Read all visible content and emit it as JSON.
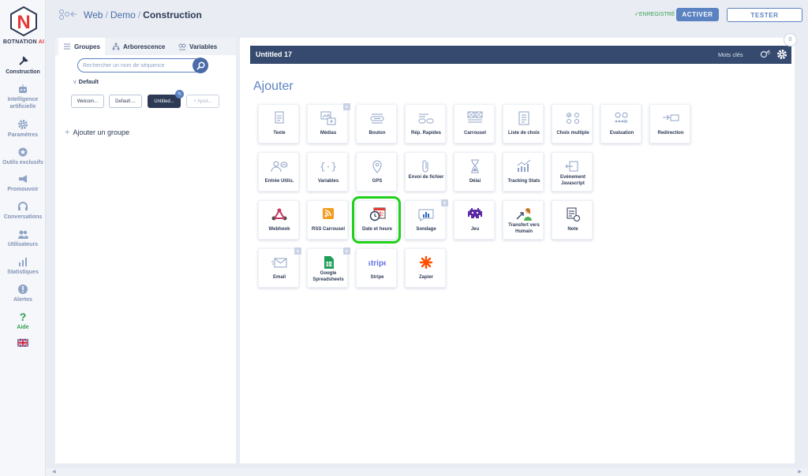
{
  "brand": {
    "name": "BOTNATION",
    "suffix": "AI",
    "logo_letter": "N"
  },
  "sidebar": {
    "items": [
      {
        "label": "Construction",
        "icon": "wrench-icon"
      },
      {
        "label": "Intelligence artificielle",
        "icon": "robot-icon"
      },
      {
        "label": "Paramètres",
        "icon": "gear-icon"
      },
      {
        "label": "Outils exclusifs",
        "icon": "star-gear-icon"
      },
      {
        "label": "Promouvoir",
        "icon": "megaphone-icon"
      },
      {
        "label": "Conversations",
        "icon": "headset-icon"
      },
      {
        "label": "Utilisateurs",
        "icon": "users-icon"
      },
      {
        "label": "Statistiques",
        "icon": "stats-icon"
      },
      {
        "label": "Alertes",
        "icon": "alert-icon"
      },
      {
        "label": "Aide",
        "icon": "question-icon"
      }
    ],
    "language_flag": "uk-flag-icon"
  },
  "header": {
    "crumb1": "Web",
    "crumb2": "Demo",
    "crumb3": "Construction",
    "sep": "/",
    "saved": "ENREGISTRÉ",
    "activate": "ACTIVER",
    "test": "TESTER"
  },
  "left_panel": {
    "tabs": [
      "Groupes",
      "Arborescence",
      "Variables"
    ],
    "search_placeholder": "Rechercher un nom de séquence",
    "group_name": "Default",
    "sequences": [
      "Welcom...",
      "Default ...",
      "Untitled..."
    ],
    "add_sequence": "+ Ajout...",
    "add_group": "Ajouter un groupe"
  },
  "main": {
    "title": "Untitled 17",
    "keywords": "Mots clés",
    "counter": "0",
    "section": "Ajouter",
    "highlight_color": "#1fd11a",
    "accent": "#5b82c1",
    "cards": [
      {
        "label": "Texte",
        "icon": "text-icon"
      },
      {
        "label": "Médias",
        "icon": "media-icon",
        "plus": true
      },
      {
        "label": "Bouton",
        "icon": "button-icon"
      },
      {
        "label": "Rép. Rapides",
        "icon": "quick-replies-icon"
      },
      {
        "label": "Carrousel",
        "icon": "carousel-icon"
      },
      {
        "label": "Liste de choix",
        "icon": "choice-list-icon"
      },
      {
        "label": "Choix multiple",
        "icon": "multiple-choice-icon"
      },
      {
        "label": "Evaluation",
        "icon": "rating-icon"
      },
      {
        "label": "Redirection",
        "icon": "redirect-icon"
      },
      {
        "label": "Entrée Utilis.",
        "icon": "user-input-icon"
      },
      {
        "label": "Variables",
        "icon": "variables-icon"
      },
      {
        "label": "GPS",
        "icon": "gps-icon"
      },
      {
        "label": "Envoi de fichier",
        "icon": "file-upload-icon"
      },
      {
        "label": "Délai",
        "icon": "hourglass-icon"
      },
      {
        "label": "Tracking Stats",
        "icon": "tracking-icon"
      },
      {
        "label": "Evénement Javascript",
        "icon": "js-event-icon"
      },
      {
        "label": "Webhook",
        "icon": "webhook-icon"
      },
      {
        "label": "RSS Carrousel",
        "icon": "rss-icon"
      },
      {
        "label": "Date et heure",
        "icon": "datetime-icon",
        "highlight": true
      },
      {
        "label": "Sondage",
        "icon": "poll-icon",
        "plus": true
      },
      {
        "label": "Jeu",
        "icon": "game-icon"
      },
      {
        "label": "Transfert vers Humain",
        "icon": "human-transfer-icon"
      },
      {
        "label": "Note",
        "icon": "note-icon"
      },
      {
        "label": "Email",
        "icon": "email-icon",
        "plus": true
      },
      {
        "label": "Google Spreadsheets",
        "icon": "spreadsheet-icon",
        "plus": true
      },
      {
        "label": "Stripe",
        "icon": "stripe-icon"
      },
      {
        "label": "Zapier",
        "icon": "zapier-icon"
      }
    ]
  }
}
